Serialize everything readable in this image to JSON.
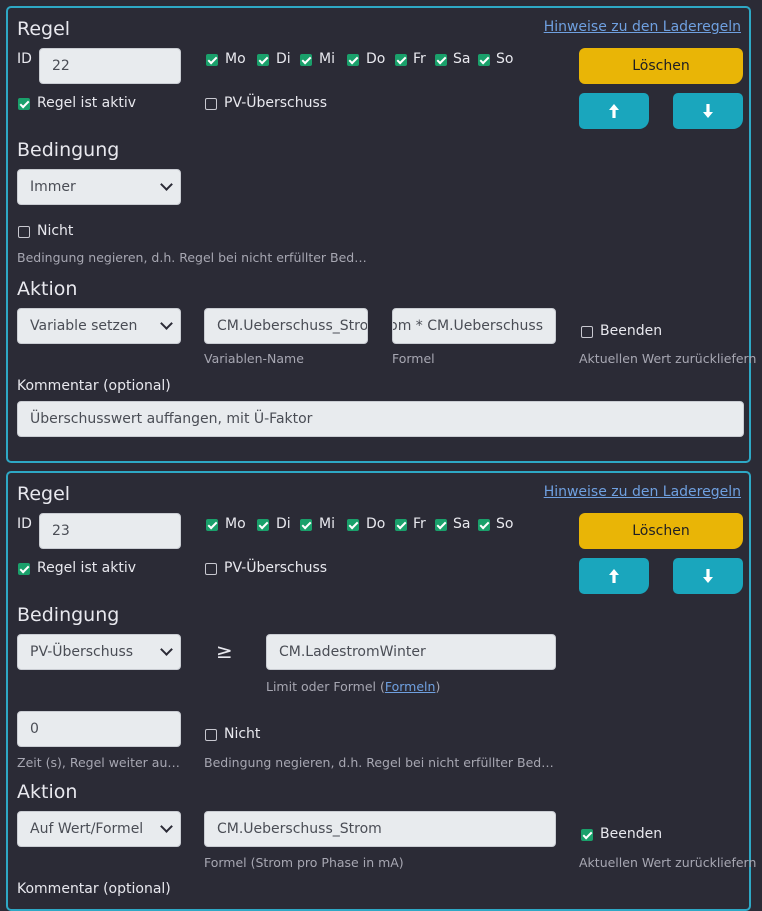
{
  "rules": [
    {
      "title": "Regel",
      "hint_link": "Hinweise zu den Laderegeln",
      "id_label": "ID",
      "id_value": "22",
      "days": [
        {
          "label": "Mo",
          "checked": true
        },
        {
          "label": "Di",
          "checked": true
        },
        {
          "label": "Mi",
          "checked": true
        },
        {
          "label": "Do",
          "checked": true
        },
        {
          "label": "Fr",
          "checked": true
        },
        {
          "label": "Sa",
          "checked": true
        },
        {
          "label": "So",
          "checked": true
        }
      ],
      "delete_label": "Löschen",
      "active_label": "Regel ist aktiv",
      "active_checked": true,
      "pv_label": "PV-Überschuss",
      "pv_checked": false,
      "condition_title": "Bedingung",
      "condition_select": "Immer",
      "not_label": "Nicht",
      "not_checked": false,
      "not_hint": "Bedingung negieren, d.h. Regel bei nicht erfüllter Bedingu...",
      "action_title": "Aktion",
      "action_select": "Variable setzen",
      "var_name_value": "CM.Ueberschuss_Strom",
      "var_name_label": "Variablen-Name",
      "formula_value": "Strom * CM.Ueberschuss",
      "formula_label": "Formel",
      "end_label": "Beenden",
      "end_checked": false,
      "end_hint": "Aktuellen Wert zurückliefern",
      "comment_label": "Kommentar (optional)",
      "comment_value": "Überschusswert auffangen, mit Ü-Faktor"
    },
    {
      "title": "Regel",
      "hint_link": "Hinweise zu den Laderegeln",
      "id_label": "ID",
      "id_value": "23",
      "days": [
        {
          "label": "Mo",
          "checked": true
        },
        {
          "label": "Di",
          "checked": true
        },
        {
          "label": "Mi",
          "checked": true
        },
        {
          "label": "Do",
          "checked": true
        },
        {
          "label": "Fr",
          "checked": true
        },
        {
          "label": "Sa",
          "checked": true
        },
        {
          "label": "So",
          "checked": true
        }
      ],
      "delete_label": "Löschen",
      "active_label": "Regel ist aktiv",
      "active_checked": true,
      "pv_label": "PV-Überschuss",
      "pv_checked": false,
      "condition_title": "Bedingung",
      "condition_select": "PV-Überschuss",
      "operator": "≥",
      "limit_value": "CM.LadestromWinter",
      "limit_hint_prefix": "Limit oder Formel (",
      "limit_hint_link": "Formeln",
      "limit_hint_suffix": ")",
      "time_value": "0",
      "time_hint": "Zeit (s), Regel weiter auführen...",
      "not_label": "Nicht",
      "not_checked": false,
      "not_hint": "Bedingung negieren, d.h. Regel bei nicht erfüllter Bedingu...",
      "action_title": "Aktion",
      "action_select": "Auf Wert/Formel",
      "value_formula": "CM.Ueberschuss_Strom",
      "value_formula_label": "Formel (Strom pro Phase in mA)",
      "end_label": "Beenden",
      "end_checked": true,
      "end_hint": "Aktuellen Wert zurückliefern",
      "comment_label": "Kommentar (optional)"
    }
  ],
  "icons": {
    "up": "arrow-up-icon",
    "down": "arrow-down-icon",
    "chevron": "chevron-down-icon",
    "check": "check-icon"
  },
  "colors": {
    "accent_border": "#2ea8c5",
    "delete_button": "#e9b506",
    "arrow_button": "#1aa6bd",
    "checkbox_on": "#1aa06b",
    "link": "#6fa0e0",
    "background": "#2b2b36"
  }
}
